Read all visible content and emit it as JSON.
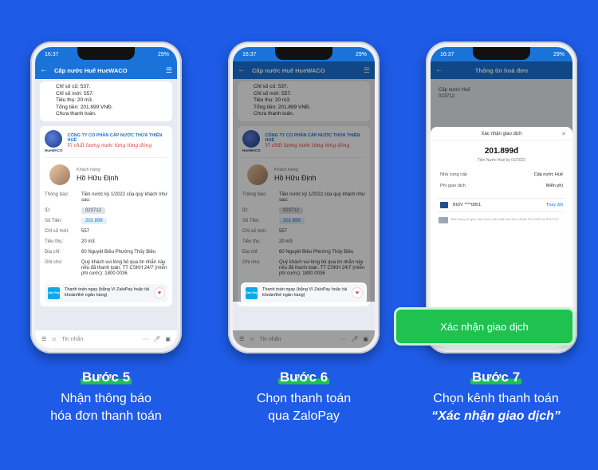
{
  "phones": [
    {
      "status_time": "16:37",
      "status_right": "29%",
      "app_title": "Cấp nước Huế HueWACO",
      "msg_top": [
        "Chỉ số cũ: 537.",
        "Chỉ số mới: 557.",
        "Tiêu thụ: 20 m3.",
        "Tổng tiền: 201.899 VNĐ.",
        "Chưa thanh toán."
      ],
      "company_name": "CÔNG TY CỔ PHẦN CẤP NƯỚC THỪA THIÊN HUẾ",
      "company_slogan": "Vì chất lượng nước từng từng dòng",
      "logo_text": "HueWACO",
      "customer_label": "Khách hàng:",
      "customer_name": "Hồ Hữu Định",
      "rows": [
        {
          "k": "Thông báo:",
          "v": "Tiền nước kỳ 1/2022 của quý khách như sau:"
        },
        {
          "k": "ID:",
          "v": "023712"
        },
        {
          "k": "Số Tiền:",
          "v": "201 899"
        },
        {
          "k": "Chỉ số mới:",
          "v": "557"
        },
        {
          "k": "Tiêu thụ:",
          "v": "20 m3"
        },
        {
          "k": "Địa chỉ:",
          "v": "60 Nguyệt Biều Phường Thủy Biều"
        },
        {
          "k": "Ghi chú:",
          "v": "Quý khách vui lòng bỏ qua tin nhắn này nếu đã thanh toán. TT CSKH 24/7 (miễn phí cước): 1800 0036"
        }
      ],
      "zalopay_text": "Thanh toán ngay (bằng Ví ZaloPay hoặc tài khoản/thẻ ngân hàng)",
      "zalopay_logo": "Zalo Pay",
      "input_placeholder": "Tin nhắn"
    },
    {
      "status_time": "16:37",
      "status_right": "29%",
      "app_title": "Cấp nước Huế HueWACO",
      "msg_top": [
        "Chỉ số cũ: 537.",
        "Chỉ số mới: 557.",
        "Tiêu thụ: 20 m3.",
        "Tổng tiền: 201.899 VNĐ.",
        "Chưa thanh toán."
      ],
      "company_name": "CÔNG TY CỔ PHẦN CẤP NƯỚC THỪA THIÊN HUẾ",
      "company_slogan": "Vì chất lượng nước từng từng dòng",
      "logo_text": "HueWACO",
      "customer_label": "Khách hàng:",
      "customer_name": "Hồ Hữu Định",
      "rows": [
        {
          "k": "Thông báo:",
          "v": "Tiền nước kỳ 1/2022 của quý khách như sau:"
        },
        {
          "k": "ID:",
          "v": "023712"
        },
        {
          "k": "Số Tiền:",
          "v": "201 899"
        },
        {
          "k": "Chỉ số mới:",
          "v": "557"
        },
        {
          "k": "Tiêu thụ:",
          "v": "20 m3"
        },
        {
          "k": "Địa chỉ:",
          "v": "60 Nguyệt Biều Phường Thủy Biều"
        },
        {
          "k": "Ghi chú:",
          "v": "Quý khách vui lòng bỏ qua tin nhắn này nếu đã thanh toán. TT CSKH 24/7 (miễn phí cước): 1800 0036"
        }
      ],
      "zalopay_text": "Thanh toán ngay (bằng Ví ZaloPay hoặc tài khoản/thẻ ngân hàng)",
      "zalopay_logo": "Zalo Pay",
      "input_placeholder": "Tin nhắn"
    }
  ],
  "phone3": {
    "status_time": "16:37",
    "status_right": "29%",
    "app_title": "Thông tin hoá đơn",
    "head_lines": [
      "Cấp nước Huế",
      "023712"
    ],
    "sheet_title": "Xác nhận giao dịch",
    "amount": "201.899đ",
    "amount_sub": "Tiền Nước Huế kỳ 01/2022",
    "provider_k": "Nhà cung cấp",
    "provider_v": "Cấp nước Huế",
    "fee_k": "Phí giao dịch",
    "fee_v": "Miễn phí",
    "bank_name": "BIDV ****0851",
    "bank_change": "Thay đổi",
    "tos": "Mọi thông tin giao dịch được bảo mật theo tiêu chuẩn PCI-DSS và SSL/TLS",
    "confirm_label": "Xác nhận giao dịch"
  },
  "captions": [
    {
      "step": "Bước 5",
      "line1": "Nhận thông báo",
      "line2": "hóa đơn thanh toán"
    },
    {
      "step": "Bước 6",
      "line1": "Chọn thanh toán",
      "line2": "qua ZaloPay"
    },
    {
      "step": "Bước 7",
      "line1": "Chọn kênh thanh toán",
      "line2": "“Xác nhận giao dịch”"
    }
  ],
  "colors": {
    "background": "#1e5be6",
    "accent_green": "#1fc24f",
    "app_blue": "#1a73d9"
  }
}
